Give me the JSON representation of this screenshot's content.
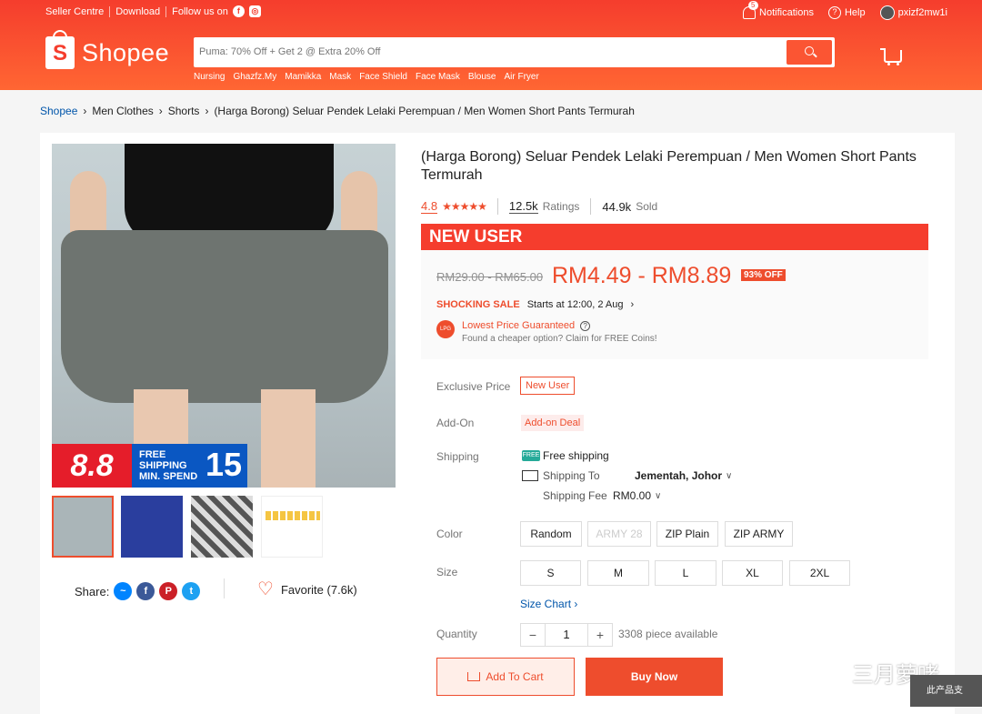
{
  "topbar": {
    "seller_centre": "Seller Centre",
    "download": "Download",
    "follow_us": "Follow us on"
  },
  "topright": {
    "notifications": "Notifications",
    "notif_count": "5",
    "help": "Help",
    "username": "pxizf2mw1i"
  },
  "logo": {
    "text": "Shopee",
    "glyph": "S"
  },
  "search": {
    "placeholder": "Puma: 70% Off + Get 2 @ Extra 20% Off",
    "hints": [
      "Nursing",
      "Ghazfz.My",
      "Mamikka",
      "Mask",
      "Face Shield",
      "Face Mask",
      "Blouse",
      "Air Fryer"
    ]
  },
  "breadcrumb": [
    "Shopee",
    "Men Clothes",
    "Shorts",
    "(Harga Borong) Seluar Pendek Lelaki Perempuan / Men Women Short Pants Termurah"
  ],
  "product": {
    "title": "(Harga Borong) Seluar Pendek Lelaki Perempuan / Men Women Short Pants Termurah",
    "rating": "4.8",
    "stars": "★★★★★",
    "ratings_count": "12.5k",
    "ratings_label": "Ratings",
    "sold_count": "44.9k",
    "sold_label": "Sold",
    "promo_88": "8.8",
    "promo_free": "FREE",
    "promo_shipping": "SHIPPING",
    "promo_min": "MIN. SPEND",
    "promo_15": "15"
  },
  "new_user_banner": "NEW USER",
  "price": {
    "original": "RM29.00 - RM65.00",
    "current": "RM4.49 - RM8.89",
    "discount": "93% OFF",
    "shocking_sale": "SHOCKING SALE",
    "sale_start": "Starts at 12:00, 2 Aug",
    "lowest_price": "Lowest Price Guaranteed",
    "cheaper_option": "Found a cheaper option? Claim for FREE Coins!"
  },
  "exclusive": {
    "label": "Exclusive Price",
    "tag": "New User"
  },
  "addon": {
    "label": "Add-On",
    "tag": "Add-on Deal"
  },
  "shipping": {
    "label": "Shipping",
    "free": "Free shipping",
    "to_label": "Shipping To",
    "to_value": "Jementah, Johor",
    "fee_label": "Shipping Fee",
    "fee_value": "RM0.00"
  },
  "color": {
    "label": "Color",
    "options": [
      "Random",
      "ARMY 28",
      "ZIP Plain",
      "ZIP ARMY"
    ]
  },
  "size": {
    "label": "Size",
    "options": [
      "S",
      "M",
      "L",
      "XL",
      "2XL"
    ],
    "chart": "Size Chart"
  },
  "quantity": {
    "label": "Quantity",
    "value": "1",
    "minus": "−",
    "plus": "+",
    "available": "3308 piece available"
  },
  "actions": {
    "add_to_cart": "Add To Cart",
    "buy_now": "Buy Now"
  },
  "share": {
    "label": "Share:",
    "favorite": "Favorite (7.6k)"
  },
  "watermark": {
    "text": "三月萝咾",
    "chip": "此产品支"
  },
  "colors": {
    "brand": "#ee4d2d",
    "header": "#f53d2d"
  }
}
